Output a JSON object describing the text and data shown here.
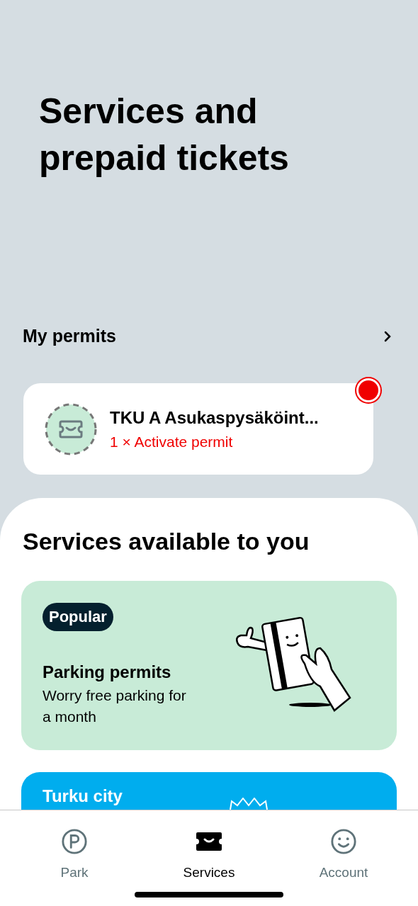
{
  "header": {
    "title": "Services and prepaid tickets"
  },
  "permits": {
    "title": "My permits",
    "items": [
      {
        "name": "TKU A Asukaspysäköint...",
        "action": "1 × Activate permit",
        "alert": true
      }
    ]
  },
  "services": {
    "title": "Services available to you",
    "cards": [
      {
        "kind": "illustrated",
        "badge": "Popular",
        "title": "Parking permits",
        "subtitle": "Worry free parking for a month",
        "color": "#c8ebd7"
      },
      {
        "kind": "city",
        "title": "Turku city",
        "color": "#00adee"
      }
    ]
  },
  "tabs": [
    {
      "kind": "park",
      "label": "Park",
      "selected": false
    },
    {
      "kind": "services",
      "label": "Services",
      "selected": true
    },
    {
      "kind": "account",
      "label": "Account",
      "selected": false
    }
  ]
}
